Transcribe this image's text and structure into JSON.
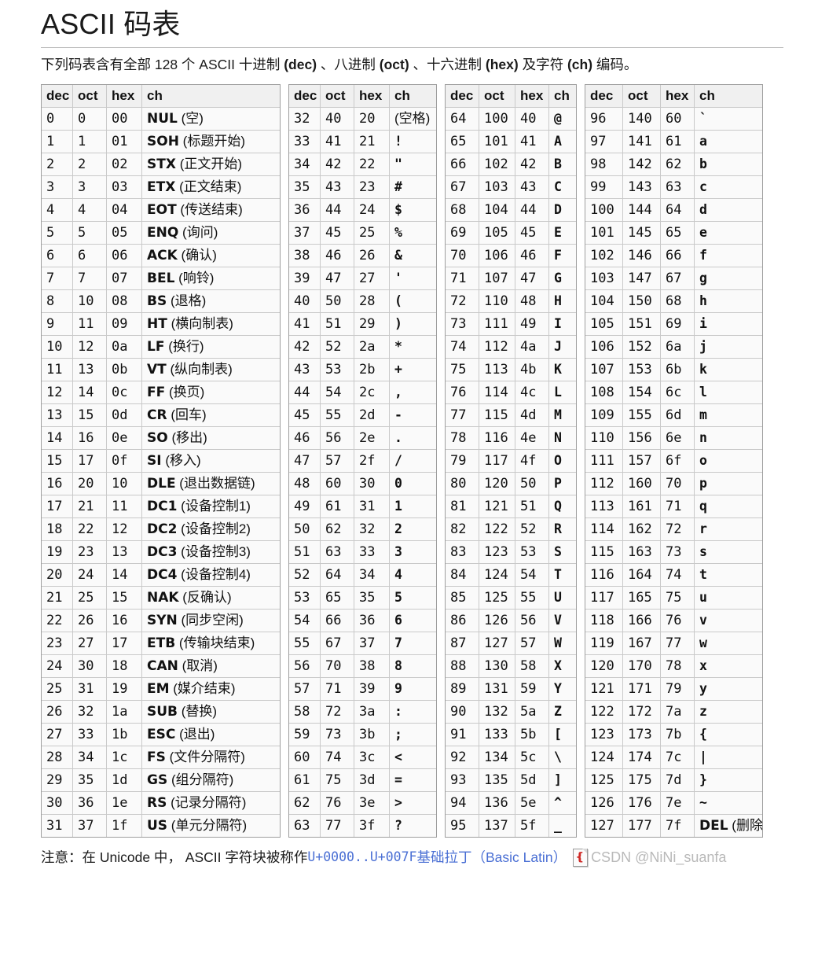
{
  "page": {
    "title": "ASCII 码表",
    "subtitle_parts": [
      {
        "t": "下列码表含有全部 128 个 ASCII 十进制 ",
        "b": false
      },
      {
        "t": "(dec)",
        "b": true
      },
      {
        "t": " 、八进制 ",
        "b": false
      },
      {
        "t": "(oct)",
        "b": true
      },
      {
        "t": " 、十六进制 ",
        "b": false
      },
      {
        "t": "(hex)",
        "b": true
      },
      {
        "t": " 及字符 ",
        "b": false
      },
      {
        "t": "(ch)",
        "b": true
      },
      {
        "t": " 编码。",
        "b": false
      }
    ]
  },
  "table": {
    "headers": [
      "dec",
      "oct",
      "hex",
      "ch"
    ],
    "blocks": [
      {
        "name": "block-0-31",
        "rows": [
          {
            "dec": "0",
            "oct": "0",
            "hex": "00",
            "abbr": "NUL",
            "desc": "(空)"
          },
          {
            "dec": "1",
            "oct": "1",
            "hex": "01",
            "abbr": "SOH",
            "desc": "(标题开始)"
          },
          {
            "dec": "2",
            "oct": "2",
            "hex": "02",
            "abbr": "STX",
            "desc": "(正文开始)"
          },
          {
            "dec": "3",
            "oct": "3",
            "hex": "03",
            "abbr": "ETX",
            "desc": "(正文结束)"
          },
          {
            "dec": "4",
            "oct": "4",
            "hex": "04",
            "abbr": "EOT",
            "desc": "(传送结束)"
          },
          {
            "dec": "5",
            "oct": "5",
            "hex": "05",
            "abbr": "ENQ",
            "desc": "(询问)"
          },
          {
            "dec": "6",
            "oct": "6",
            "hex": "06",
            "abbr": "ACK",
            "desc": "(确认)"
          },
          {
            "dec": "7",
            "oct": "7",
            "hex": "07",
            "abbr": "BEL",
            "desc": "(响铃)"
          },
          {
            "dec": "8",
            "oct": "10",
            "hex": "08",
            "abbr": "BS",
            "desc": "(退格)"
          },
          {
            "dec": "9",
            "oct": "11",
            "hex": "09",
            "abbr": "HT",
            "desc": "(横向制表)"
          },
          {
            "dec": "10",
            "oct": "12",
            "hex": "0a",
            "abbr": "LF",
            "desc": "(换行)"
          },
          {
            "dec": "11",
            "oct": "13",
            "hex": "0b",
            "abbr": "VT",
            "desc": "(纵向制表)"
          },
          {
            "dec": "12",
            "oct": "14",
            "hex": "0c",
            "abbr": "FF",
            "desc": "(换页)"
          },
          {
            "dec": "13",
            "oct": "15",
            "hex": "0d",
            "abbr": "CR",
            "desc": "(回车)"
          },
          {
            "dec": "14",
            "oct": "16",
            "hex": "0e",
            "abbr": "SO",
            "desc": "(移出)"
          },
          {
            "dec": "15",
            "oct": "17",
            "hex": "0f",
            "abbr": "SI",
            "desc": "(移入)"
          },
          {
            "dec": "16",
            "oct": "20",
            "hex": "10",
            "abbr": "DLE",
            "desc": "(退出数据链)"
          },
          {
            "dec": "17",
            "oct": "21",
            "hex": "11",
            "abbr": "DC1",
            "desc": "(设备控制1)"
          },
          {
            "dec": "18",
            "oct": "22",
            "hex": "12",
            "abbr": "DC2",
            "desc": "(设备控制2)"
          },
          {
            "dec": "19",
            "oct": "23",
            "hex": "13",
            "abbr": "DC3",
            "desc": "(设备控制3)"
          },
          {
            "dec": "20",
            "oct": "24",
            "hex": "14",
            "abbr": "DC4",
            "desc": "(设备控制4)"
          },
          {
            "dec": "21",
            "oct": "25",
            "hex": "15",
            "abbr": "NAK",
            "desc": "(反确认)"
          },
          {
            "dec": "22",
            "oct": "26",
            "hex": "16",
            "abbr": "SYN",
            "desc": "(同步空闲)"
          },
          {
            "dec": "23",
            "oct": "27",
            "hex": "17",
            "abbr": "ETB",
            "desc": "(传输块结束)"
          },
          {
            "dec": "24",
            "oct": "30",
            "hex": "18",
            "abbr": "CAN",
            "desc": "(取消)"
          },
          {
            "dec": "25",
            "oct": "31",
            "hex": "19",
            "abbr": "EM",
            "desc": "(媒介结束)"
          },
          {
            "dec": "26",
            "oct": "32",
            "hex": "1a",
            "abbr": "SUB",
            "desc": "(替换)"
          },
          {
            "dec": "27",
            "oct": "33",
            "hex": "1b",
            "abbr": "ESC",
            "desc": "(退出)"
          },
          {
            "dec": "28",
            "oct": "34",
            "hex": "1c",
            "abbr": "FS",
            "desc": "(文件分隔符)"
          },
          {
            "dec": "29",
            "oct": "35",
            "hex": "1d",
            "abbr": "GS",
            "desc": "(组分隔符)"
          },
          {
            "dec": "30",
            "oct": "36",
            "hex": "1e",
            "abbr": "RS",
            "desc": "(记录分隔符)"
          },
          {
            "dec": "31",
            "oct": "37",
            "hex": "1f",
            "abbr": "US",
            "desc": "(单元分隔符)"
          }
        ]
      },
      {
        "name": "block-32-63",
        "rows": [
          {
            "dec": "32",
            "oct": "40",
            "hex": "20",
            "abbr": "",
            "desc": "(空格)"
          },
          {
            "dec": "33",
            "oct": "41",
            "hex": "21",
            "glyph": "!"
          },
          {
            "dec": "34",
            "oct": "42",
            "hex": "22",
            "glyph": "\""
          },
          {
            "dec": "35",
            "oct": "43",
            "hex": "23",
            "glyph": "#"
          },
          {
            "dec": "36",
            "oct": "44",
            "hex": "24",
            "glyph": "$"
          },
          {
            "dec": "37",
            "oct": "45",
            "hex": "25",
            "glyph": "%"
          },
          {
            "dec": "38",
            "oct": "46",
            "hex": "26",
            "glyph": "&"
          },
          {
            "dec": "39",
            "oct": "47",
            "hex": "27",
            "glyph": "'"
          },
          {
            "dec": "40",
            "oct": "50",
            "hex": "28",
            "glyph": "("
          },
          {
            "dec": "41",
            "oct": "51",
            "hex": "29",
            "glyph": ")"
          },
          {
            "dec": "42",
            "oct": "52",
            "hex": "2a",
            "glyph": "*"
          },
          {
            "dec": "43",
            "oct": "53",
            "hex": "2b",
            "glyph": "+"
          },
          {
            "dec": "44",
            "oct": "54",
            "hex": "2c",
            "glyph": ","
          },
          {
            "dec": "45",
            "oct": "55",
            "hex": "2d",
            "glyph": "-"
          },
          {
            "dec": "46",
            "oct": "56",
            "hex": "2e",
            "glyph": "."
          },
          {
            "dec": "47",
            "oct": "57",
            "hex": "2f",
            "glyph": "/"
          },
          {
            "dec": "48",
            "oct": "60",
            "hex": "30",
            "glyph": "0"
          },
          {
            "dec": "49",
            "oct": "61",
            "hex": "31",
            "glyph": "1"
          },
          {
            "dec": "50",
            "oct": "62",
            "hex": "32",
            "glyph": "2"
          },
          {
            "dec": "51",
            "oct": "63",
            "hex": "33",
            "glyph": "3"
          },
          {
            "dec": "52",
            "oct": "64",
            "hex": "34",
            "glyph": "4"
          },
          {
            "dec": "53",
            "oct": "65",
            "hex": "35",
            "glyph": "5"
          },
          {
            "dec": "54",
            "oct": "66",
            "hex": "36",
            "glyph": "6"
          },
          {
            "dec": "55",
            "oct": "67",
            "hex": "37",
            "glyph": "7"
          },
          {
            "dec": "56",
            "oct": "70",
            "hex": "38",
            "glyph": "8"
          },
          {
            "dec": "57",
            "oct": "71",
            "hex": "39",
            "glyph": "9"
          },
          {
            "dec": "58",
            "oct": "72",
            "hex": "3a",
            "glyph": ":"
          },
          {
            "dec": "59",
            "oct": "73",
            "hex": "3b",
            "glyph": ";"
          },
          {
            "dec": "60",
            "oct": "74",
            "hex": "3c",
            "glyph": "<"
          },
          {
            "dec": "61",
            "oct": "75",
            "hex": "3d",
            "glyph": "="
          },
          {
            "dec": "62",
            "oct": "76",
            "hex": "3e",
            "glyph": ">"
          },
          {
            "dec": "63",
            "oct": "77",
            "hex": "3f",
            "glyph": "?"
          }
        ]
      },
      {
        "name": "block-64-95",
        "rows": [
          {
            "dec": "64",
            "oct": "100",
            "hex": "40",
            "glyph": "@"
          },
          {
            "dec": "65",
            "oct": "101",
            "hex": "41",
            "glyph": "A"
          },
          {
            "dec": "66",
            "oct": "102",
            "hex": "42",
            "glyph": "B"
          },
          {
            "dec": "67",
            "oct": "103",
            "hex": "43",
            "glyph": "C"
          },
          {
            "dec": "68",
            "oct": "104",
            "hex": "44",
            "glyph": "D"
          },
          {
            "dec": "69",
            "oct": "105",
            "hex": "45",
            "glyph": "E"
          },
          {
            "dec": "70",
            "oct": "106",
            "hex": "46",
            "glyph": "F"
          },
          {
            "dec": "71",
            "oct": "107",
            "hex": "47",
            "glyph": "G"
          },
          {
            "dec": "72",
            "oct": "110",
            "hex": "48",
            "glyph": "H"
          },
          {
            "dec": "73",
            "oct": "111",
            "hex": "49",
            "glyph": "I"
          },
          {
            "dec": "74",
            "oct": "112",
            "hex": "4a",
            "glyph": "J"
          },
          {
            "dec": "75",
            "oct": "113",
            "hex": "4b",
            "glyph": "K"
          },
          {
            "dec": "76",
            "oct": "114",
            "hex": "4c",
            "glyph": "L"
          },
          {
            "dec": "77",
            "oct": "115",
            "hex": "4d",
            "glyph": "M"
          },
          {
            "dec": "78",
            "oct": "116",
            "hex": "4e",
            "glyph": "N"
          },
          {
            "dec": "79",
            "oct": "117",
            "hex": "4f",
            "glyph": "O"
          },
          {
            "dec": "80",
            "oct": "120",
            "hex": "50",
            "glyph": "P"
          },
          {
            "dec": "81",
            "oct": "121",
            "hex": "51",
            "glyph": "Q"
          },
          {
            "dec": "82",
            "oct": "122",
            "hex": "52",
            "glyph": "R"
          },
          {
            "dec": "83",
            "oct": "123",
            "hex": "53",
            "glyph": "S"
          },
          {
            "dec": "84",
            "oct": "124",
            "hex": "54",
            "glyph": "T"
          },
          {
            "dec": "85",
            "oct": "125",
            "hex": "55",
            "glyph": "U"
          },
          {
            "dec": "86",
            "oct": "126",
            "hex": "56",
            "glyph": "V"
          },
          {
            "dec": "87",
            "oct": "127",
            "hex": "57",
            "glyph": "W"
          },
          {
            "dec": "88",
            "oct": "130",
            "hex": "58",
            "glyph": "X"
          },
          {
            "dec": "89",
            "oct": "131",
            "hex": "59",
            "glyph": "Y"
          },
          {
            "dec": "90",
            "oct": "132",
            "hex": "5a",
            "glyph": "Z"
          },
          {
            "dec": "91",
            "oct": "133",
            "hex": "5b",
            "glyph": "["
          },
          {
            "dec": "92",
            "oct": "134",
            "hex": "5c",
            "glyph": "\\"
          },
          {
            "dec": "93",
            "oct": "135",
            "hex": "5d",
            "glyph": "]"
          },
          {
            "dec": "94",
            "oct": "136",
            "hex": "5e",
            "glyph": "^"
          },
          {
            "dec": "95",
            "oct": "137",
            "hex": "5f",
            "glyph": "_"
          }
        ]
      },
      {
        "name": "block-96-127",
        "rows": [
          {
            "dec": "96",
            "oct": "140",
            "hex": "60",
            "glyph": "`"
          },
          {
            "dec": "97",
            "oct": "141",
            "hex": "61",
            "glyph": "a"
          },
          {
            "dec": "98",
            "oct": "142",
            "hex": "62",
            "glyph": "b"
          },
          {
            "dec": "99",
            "oct": "143",
            "hex": "63",
            "glyph": "c"
          },
          {
            "dec": "100",
            "oct": "144",
            "hex": "64",
            "glyph": "d"
          },
          {
            "dec": "101",
            "oct": "145",
            "hex": "65",
            "glyph": "e"
          },
          {
            "dec": "102",
            "oct": "146",
            "hex": "66",
            "glyph": "f"
          },
          {
            "dec": "103",
            "oct": "147",
            "hex": "67",
            "glyph": "g"
          },
          {
            "dec": "104",
            "oct": "150",
            "hex": "68",
            "glyph": "h"
          },
          {
            "dec": "105",
            "oct": "151",
            "hex": "69",
            "glyph": "i"
          },
          {
            "dec": "106",
            "oct": "152",
            "hex": "6a",
            "glyph": "j"
          },
          {
            "dec": "107",
            "oct": "153",
            "hex": "6b",
            "glyph": "k"
          },
          {
            "dec": "108",
            "oct": "154",
            "hex": "6c",
            "glyph": "l"
          },
          {
            "dec": "109",
            "oct": "155",
            "hex": "6d",
            "glyph": "m"
          },
          {
            "dec": "110",
            "oct": "156",
            "hex": "6e",
            "glyph": "n"
          },
          {
            "dec": "111",
            "oct": "157",
            "hex": "6f",
            "glyph": "o"
          },
          {
            "dec": "112",
            "oct": "160",
            "hex": "70",
            "glyph": "p"
          },
          {
            "dec": "113",
            "oct": "161",
            "hex": "71",
            "glyph": "q"
          },
          {
            "dec": "114",
            "oct": "162",
            "hex": "72",
            "glyph": "r"
          },
          {
            "dec": "115",
            "oct": "163",
            "hex": "73",
            "glyph": "s"
          },
          {
            "dec": "116",
            "oct": "164",
            "hex": "74",
            "glyph": "t"
          },
          {
            "dec": "117",
            "oct": "165",
            "hex": "75",
            "glyph": "u"
          },
          {
            "dec": "118",
            "oct": "166",
            "hex": "76",
            "glyph": "v"
          },
          {
            "dec": "119",
            "oct": "167",
            "hex": "77",
            "glyph": "w"
          },
          {
            "dec": "120",
            "oct": "170",
            "hex": "78",
            "glyph": "x"
          },
          {
            "dec": "121",
            "oct": "171",
            "hex": "79",
            "glyph": "y"
          },
          {
            "dec": "122",
            "oct": "172",
            "hex": "7a",
            "glyph": "z"
          },
          {
            "dec": "123",
            "oct": "173",
            "hex": "7b",
            "glyph": "{"
          },
          {
            "dec": "124",
            "oct": "174",
            "hex": "7c",
            "glyph": "|"
          },
          {
            "dec": "125",
            "oct": "175",
            "hex": "7d",
            "glyph": "}"
          },
          {
            "dec": "126",
            "oct": "176",
            "hex": "7e",
            "glyph": "~"
          },
          {
            "dec": "127",
            "oct": "177",
            "hex": "7f",
            "abbr": "DEL",
            "desc": "(删除)"
          }
        ]
      }
    ]
  },
  "footnote": {
    "prefix": "注意：在 Unicode 中， ASCII 字符块被称作 ",
    "code_range": "U+0000..U+007F",
    "name_cn": " 基础拉丁（",
    "name_en": "Basic Latin",
    "suffix": "）",
    "icon": "pdf-icon",
    "watermark": "CSDN @NiNi_suanfa"
  },
  "colors": {
    "link": "#4a6fd4",
    "cell_bg": "#fafafa",
    "header_bg": "#f0f0f0",
    "border": "#c9c9c9",
    "outer_border": "#9e9e9e",
    "watermark": "#b9b9b9",
    "pdf_red": "#cf2a27"
  }
}
